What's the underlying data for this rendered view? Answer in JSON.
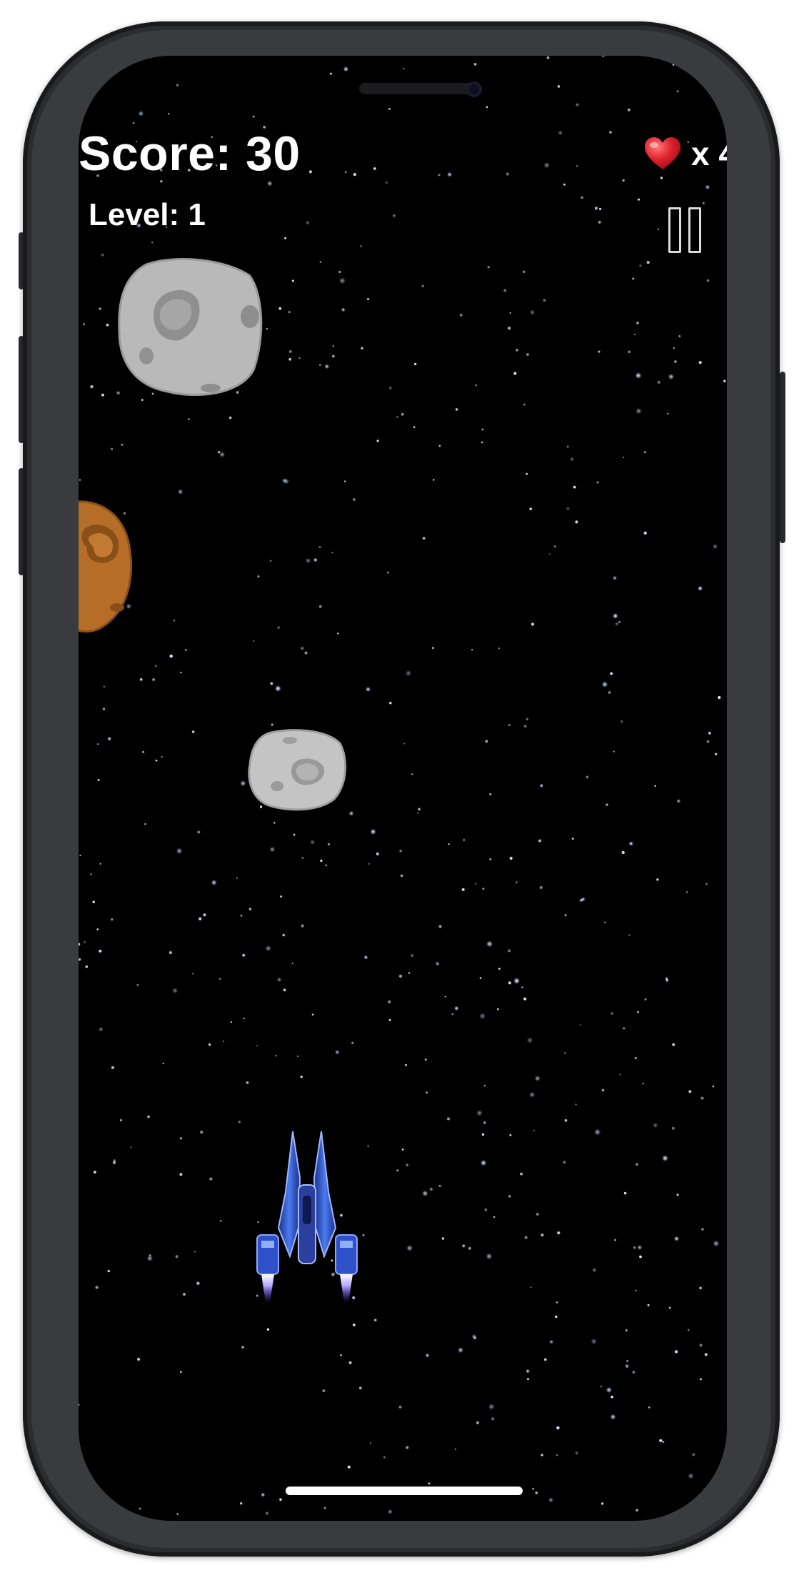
{
  "hud": {
    "score_label": "Score: 30",
    "level_label": "Level: 1",
    "lives_count": "x 4"
  },
  "icons": {
    "lives": "heart-icon",
    "pause": "pause-icon",
    "player": "spaceship",
    "asteroid_gray": "asteroid-gray",
    "asteroid_brown": "asteroid-brown"
  },
  "colors": {
    "background": "#000000",
    "hud_text": "#ffffff",
    "heart": "#e0242e",
    "ship": "#2f5bd4",
    "asteroid_gray": "#b8b8b8",
    "asteroid_brown": "#b06a2a"
  }
}
